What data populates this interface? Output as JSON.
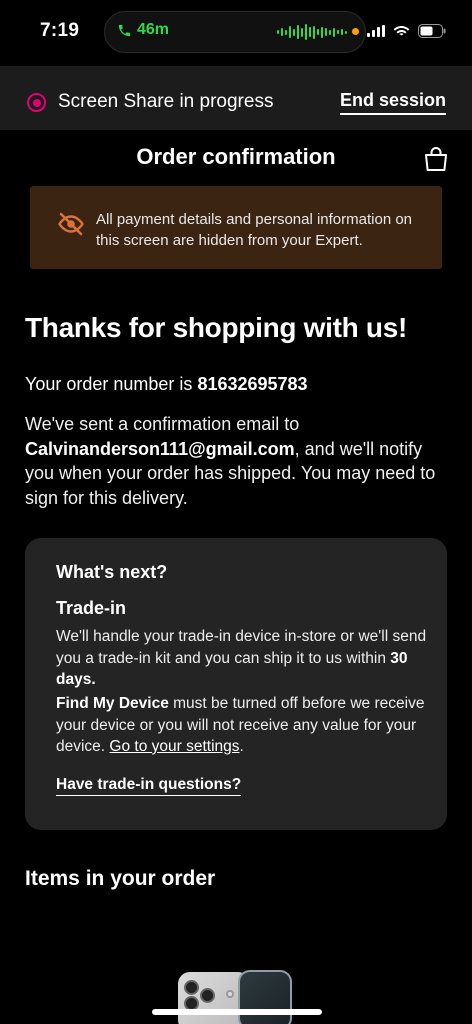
{
  "status_bar": {
    "time": "7:19",
    "call_duration": "46m",
    "call_color": "#32d74b",
    "icons": [
      "phone-icon",
      "waveform-icon",
      "orange-dot",
      "signal-icon",
      "wifi-icon",
      "battery-icon"
    ]
  },
  "screen_share": {
    "status_text": "Screen Share in progress",
    "end_label": "End session",
    "accent": "#e20074"
  },
  "header": {
    "title": "Order confirmation",
    "cart_icon": "shopping-bag-icon"
  },
  "privacy_notice": {
    "icon": "eye-off-icon",
    "text": "All payment details and personal information on this screen are hidden from your Expert.",
    "background": "#3c2412",
    "icon_color": "#d9733a"
  },
  "confirmation": {
    "heading": "Thanks for shopping with us!",
    "order_prefix": "Your order number is ",
    "order_number": "81632695783",
    "email_prefix": "We've sent a confirmation email to ",
    "email": "Calvinanderson111@gmail.com",
    "email_suffix": ", and we'll notify you when your order has shipped. You may need to sign for this delivery."
  },
  "whats_next": {
    "title": "What's next?",
    "tradein_title": "Trade-in",
    "tradein_text": "We'll handle your trade-in device in-store or we'll send you a trade-in kit and you can ship it to us within ",
    "tradein_days": "30 days.",
    "findmy_label": "Find My Device",
    "findmy_text": " must be turned off before we receive your device or you will not receive any value for your device. ",
    "settings_link": "Go to your settings",
    "settings_suffix": ".",
    "questions_link": "Have trade-in questions?"
  },
  "items": {
    "title": "Items in your order",
    "product_image": "iphone-image"
  }
}
